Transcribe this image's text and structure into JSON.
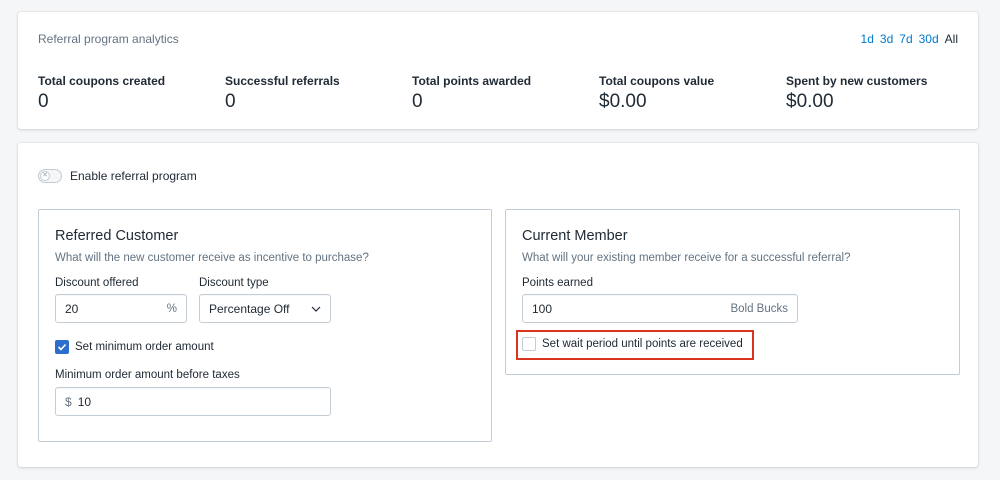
{
  "analytics": {
    "heading": "Referral program analytics",
    "ranges": [
      "1d",
      "3d",
      "7d",
      "30d",
      "All"
    ],
    "active_range": "All",
    "stats": [
      {
        "label": "Total coupons created",
        "value": "0"
      },
      {
        "label": "Successful referrals",
        "value": "0"
      },
      {
        "label": "Total points awarded",
        "value": "0"
      },
      {
        "label": "Total coupons value",
        "value": "$0.00"
      },
      {
        "label": "Spent by new customers",
        "value": "$0.00"
      }
    ]
  },
  "settings": {
    "enable_label": "Enable referral program",
    "enabled": false,
    "referred": {
      "title": "Referred Customer",
      "subtitle": "What will the new customer receive as incentive to purchase?",
      "discount_label": "Discount offered",
      "discount_value": "20",
      "discount_suffix": "%",
      "type_label": "Discount type",
      "type_value": "Percentage Off",
      "min_order_checkbox": "Set minimum order amount",
      "min_order_checked": true,
      "min_amount_label": "Minimum order amount before taxes",
      "min_amount_prefix": "$",
      "min_amount_value": "10"
    },
    "member": {
      "title": "Current Member",
      "subtitle": "What will your existing member receive for a successful referral?",
      "points_label": "Points earned",
      "points_value": "100",
      "points_suffix": "Bold Bucks",
      "wait_checkbox": "Set wait period until points are received",
      "wait_checked": false
    }
  },
  "colors": {
    "link": "#007ace",
    "checkbox_checked": "#2c6ecb",
    "highlight": "#d9341d"
  }
}
